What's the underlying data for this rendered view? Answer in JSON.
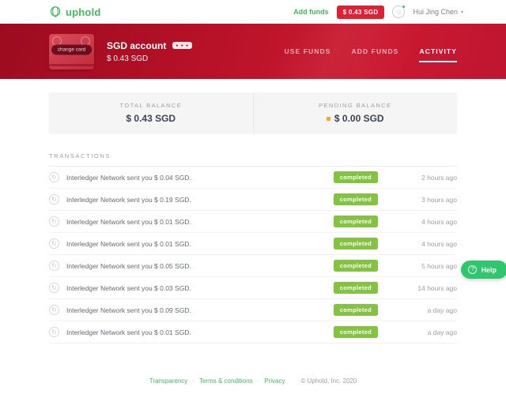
{
  "brand": {
    "name": "uphold",
    "green": "#3fbb5f",
    "red": "#c01530",
    "status_green": "#83c341",
    "pending_yellow": "#f5a623"
  },
  "header": {
    "add_funds_label": "Add funds",
    "balance_badge": "$ 0.43 SGD",
    "user_name": "Hui Jing Chen",
    "caret": "▾",
    "avatar_icon": "☺"
  },
  "banner": {
    "change_card_label": "change card",
    "account_title": "SGD account",
    "account_balance": "$ 0.43 SGD",
    "menu_icon": "● ● ●",
    "tabs": [
      {
        "label": "USE FUNDS",
        "active": false
      },
      {
        "label": "ADD FUNDS",
        "active": false
      },
      {
        "label": "ACTIVITY",
        "active": true
      }
    ]
  },
  "balances": {
    "total": {
      "label": "TOTAL BALANCE",
      "value": "$ 0.43 SGD"
    },
    "pending": {
      "label": "PENDING BALANCE",
      "value": "$ 0.00 SGD"
    }
  },
  "transactions": {
    "section_label": "TRANSACTIONS",
    "row_icon": "↻",
    "rows": [
      {
        "text": "Interledger Network sent you $ 0.04 SGD.",
        "status": "completed",
        "time": "2 hours ago"
      },
      {
        "text": "Interledger Network sent you $ 0.19 SGD.",
        "status": "completed",
        "time": "3 hours ago"
      },
      {
        "text": "Interledger Network sent you $ 0.01 SGD.",
        "status": "completed",
        "time": "4 hours ago"
      },
      {
        "text": "Interledger Network sent you $ 0.01 SGD.",
        "status": "completed",
        "time": "4 hours ago"
      },
      {
        "text": "Interledger Network sent you $ 0.05 SGD.",
        "status": "completed",
        "time": "5 hours ago"
      },
      {
        "text": "Interledger Network sent you $ 0.03 SGD.",
        "status": "completed",
        "time": "14 hours ago"
      },
      {
        "text": "Interledger Network sent you $ 0.09 SGD.",
        "status": "completed",
        "time": "a day ago"
      },
      {
        "text": "Interledger Network sent you $ 0.01 SGD.",
        "status": "completed",
        "time": "a day ago"
      }
    ]
  },
  "help_button": {
    "label": "Help",
    "icon": "?"
  },
  "footer": {
    "links": [
      "Transparency",
      "Terms & conditions",
      "Privacy"
    ],
    "separator": "·",
    "copyright": "© Uphold, Inc. 2020"
  }
}
